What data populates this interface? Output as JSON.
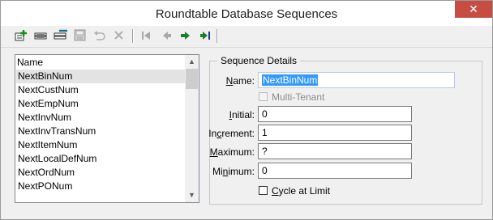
{
  "window": {
    "title": "Roundtable Database Sequences",
    "close_glyph": "✕"
  },
  "toolbar": {
    "buttons": [
      {
        "name": "new-icon"
      },
      {
        "name": "copy-icon"
      },
      {
        "name": "modify-icon"
      },
      {
        "name": "save-icon",
        "disabled": true
      },
      {
        "name": "undo-icon",
        "disabled": true
      },
      {
        "name": "delete-icon",
        "disabled": true
      },
      {
        "name": "first-icon"
      },
      {
        "name": "previous-icon"
      },
      {
        "name": "next-icon"
      },
      {
        "name": "last-icon"
      }
    ]
  },
  "list": {
    "header": "Name",
    "items": [
      "NextBinNum",
      "NextCustNum",
      "NextEmpNum",
      "NextInvNum",
      "NextInvTransNum",
      "NextItemNum",
      "NextLocalDefNum",
      "NextOrdNum",
      "NextPONum"
    ],
    "selected": "NextBinNum",
    "scroll_up": "▲",
    "scroll_down": "▼"
  },
  "details": {
    "group_label": "Sequence Details",
    "name": {
      "label_pre": "",
      "label_ul": "N",
      "label_post": "ame:",
      "value": "NextBinNum"
    },
    "multi_tenant": {
      "label": "Multi-Tenant",
      "checked": false,
      "disabled": true
    },
    "initial": {
      "label_pre": "",
      "label_ul": "I",
      "label_post": "nitial:",
      "value": "0"
    },
    "increment": {
      "label_pre": "In",
      "label_ul": "c",
      "label_post": "rement:",
      "value": "1"
    },
    "maximum": {
      "label_pre": "",
      "label_ul": "M",
      "label_post": "aximum:",
      "value": "?"
    },
    "minimum": {
      "label_pre": "Mi",
      "label_ul": "n",
      "label_post": "imum:",
      "value": "0"
    },
    "cycle": {
      "label_pre": "",
      "label_ul": "C",
      "label_post": "ycle at Limit",
      "checked": false
    }
  }
}
